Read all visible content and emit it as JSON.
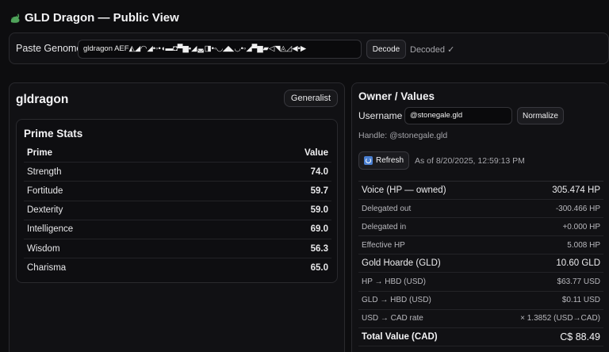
{
  "header": {
    "title": "GLD Dragon — Public View"
  },
  "genome": {
    "label": "Paste Genome",
    "value": "gldragon AEF◭◢◠◢•◦•◖▬◘▀▆▪◢◛◨•◦◟◞◢◣◡•◦◢▀▆▰◁◥◬◿◀•▶",
    "decode_label": "Decode",
    "status": "Decoded ✓"
  },
  "dragon": {
    "name": "gldragon",
    "badge": "Generalist",
    "stats_title": "Prime Stats",
    "col_prime": "Prime",
    "col_value": "Value",
    "stats": [
      {
        "name": "Strength",
        "value": "74.0"
      },
      {
        "name": "Fortitude",
        "value": "59.7"
      },
      {
        "name": "Dexterity",
        "value": "59.0"
      },
      {
        "name": "Intelligence",
        "value": "69.0"
      },
      {
        "name": "Wisdom",
        "value": "56.3"
      },
      {
        "name": "Charisma",
        "value": "65.0"
      }
    ]
  },
  "owner": {
    "title": "Owner / Values",
    "username_label": "Username",
    "username_value": "@stonegale.gld",
    "normalize_label": "Normalize",
    "handle": "Handle: @stonegale.gld",
    "refresh_label": "Refresh",
    "as_of": "As of 8/20/2025, 12:59:13 PM",
    "rows": [
      {
        "label": "Voice (HP — owned)",
        "value": "305.474 HP",
        "kind": "major"
      },
      {
        "label": "Delegated out",
        "value": "-300.466 HP",
        "kind": "minor"
      },
      {
        "label": "Delegated in",
        "value": "+0.000 HP",
        "kind": "minor"
      },
      {
        "label": "Effective HP",
        "value": "5.008 HP",
        "kind": "minor"
      },
      {
        "label": "Gold Hoarde (GLD)",
        "value": "10.60 GLD",
        "kind": "major"
      },
      {
        "label": "HP → HBD (USD)",
        "value": "$63.77 USD",
        "kind": "minor"
      },
      {
        "label": "GLD → HBD (USD)",
        "value": "$0.11 USD",
        "kind": "minor"
      },
      {
        "label": "USD → CAD rate",
        "value": "× 1.3852 (USD→CAD)",
        "kind": "minor"
      },
      {
        "label": "Total Value (CAD)",
        "value": "C$ 88.49",
        "kind": "total"
      }
    ]
  },
  "icons": {
    "title_icon": "dragon-icon",
    "refresh_icon": "refresh-icon"
  },
  "colors": {
    "background": "#0d0d0f",
    "panel": "#111114",
    "border": "#2a2a2e",
    "accent": "#4a7fd1"
  }
}
